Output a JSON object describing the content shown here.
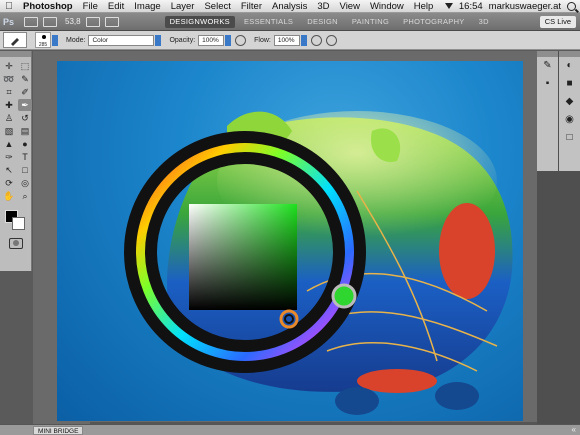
{
  "menubar": {
    "app_name": "Photoshop",
    "menus": [
      "File",
      "Edit",
      "Image",
      "Layer",
      "Select",
      "Filter",
      "Analysis",
      "3D",
      "View",
      "Window",
      "Help"
    ],
    "clock": "16:54",
    "user": "markuswaeger.at"
  },
  "appbar": {
    "logo": "Ps",
    "zoom": "53,8",
    "workspaces": [
      "DESIGNWORKS",
      "ESSENTIALS",
      "DESIGN",
      "PAINTING",
      "PHOTOGRAPHY",
      "3D"
    ],
    "active_workspace": "DESIGNWORKS",
    "cs_live": "CS Live"
  },
  "options": {
    "brush_size": "285",
    "mode_label": "Mode:",
    "mode_value": "Color",
    "opacity_label": "Opacity:",
    "opacity_value": "100%",
    "flow_label": "Flow:",
    "flow_value": "100%"
  },
  "tools": {
    "icons": [
      "move-icon",
      "marquee-icon",
      "lasso-icon",
      "quick-select-icon",
      "crop-icon",
      "eyedropper-icon",
      "healing-icon",
      "brush-icon",
      "stamp-icon",
      "history-brush-icon",
      "eraser-icon",
      "gradient-icon",
      "blur-icon",
      "dodge-icon",
      "pen-icon",
      "type-icon",
      "path-select-icon",
      "shape-icon",
      "3d-rotate-icon",
      "3d-orbit-icon",
      "hand-icon",
      "zoom-icon"
    ],
    "active_tool": "brush-icon",
    "foreground_color": "#000000",
    "background_color": "#ffffff"
  },
  "picker": {
    "ring_colors": [
      "#ff3b30",
      "#ffcc00",
      "#7bff2a",
      "#2aff7a",
      "#00e0ff",
      "#2a6bff",
      "#b54aff",
      "#ff3bd6",
      "#ff3b30"
    ],
    "selected_color": "#2fd62f"
  },
  "bottom": {
    "mini_bridge": "MINI BRIDGE"
  }
}
